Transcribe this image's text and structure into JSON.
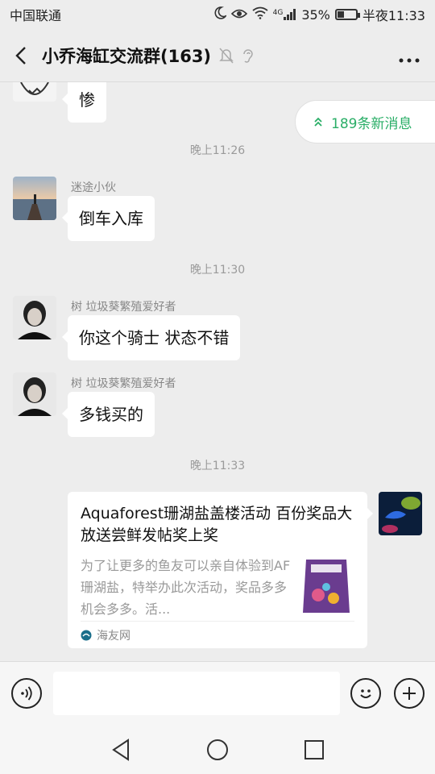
{
  "status_bar": {
    "carrier": "中国联通",
    "signal_text": "4G",
    "battery_percent": "35%",
    "battery_level": 0.35,
    "time": "半夜11:33"
  },
  "header": {
    "title": "小乔海缸交流群(163)",
    "back_icon": "chevron-left-icon",
    "mute_icon": "bell-off-icon",
    "ear_icon": "ear-icon",
    "more_icon": "ellipsis-icon"
  },
  "new_messages": {
    "label": "189条新消息",
    "color": "#2aae67"
  },
  "messages": [
    {
      "type": "text",
      "text": "惨"
    },
    {
      "type": "time",
      "text": "晚上11:26"
    },
    {
      "type": "text",
      "sender": "迷途小伙",
      "text": "倒车入库"
    },
    {
      "type": "time",
      "text": "晚上11:30"
    },
    {
      "type": "text",
      "sender": "树 垃圾葵繁殖爱好者",
      "text": "你这个骑士 状态不错"
    },
    {
      "type": "text",
      "sender": "树 垃圾葵繁殖爱好者",
      "text": "多钱买的"
    },
    {
      "type": "time",
      "text": "晚上11:33"
    },
    {
      "type": "link",
      "title": "Aquaforest珊湖盐盖楼活动 百份奖品大放送尝鲜发帖奖上奖",
      "description": "为了让更多的鱼友可以亲自体验到AF珊湖盐，特举办此次活动，奖品多多机会多多。活...",
      "source": "海友网",
      "thumb_icon": "product-bag-icon"
    }
  ],
  "input_bar": {
    "voice_icon": "voice-icon",
    "placeholder": "",
    "emoji_icon": "emoji-icon",
    "plus_icon": "plus-icon"
  },
  "nav_bar": {
    "back_icon": "triangle-back-icon",
    "home_icon": "circle-home-icon",
    "recents_icon": "square-recents-icon"
  }
}
